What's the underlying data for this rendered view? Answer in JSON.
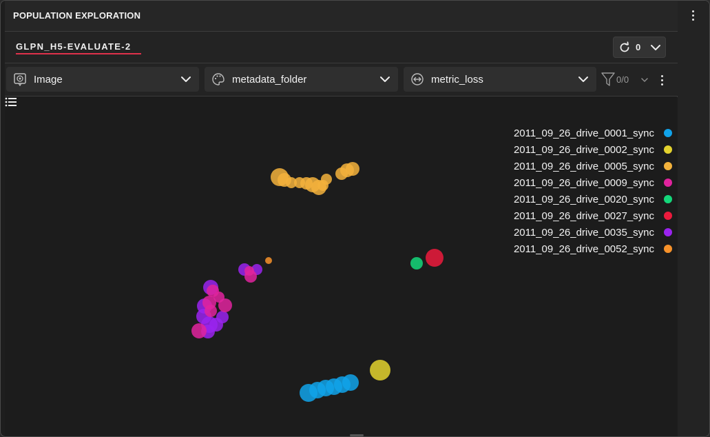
{
  "header": {
    "title": "POPULATION EXPLORATION"
  },
  "tab": {
    "label": "GLPN_H5-EVALUATE-2",
    "accent": "#e0314b"
  },
  "refresh": {
    "count": "0",
    "icon": "refresh-icon"
  },
  "controls": {
    "image_select": {
      "label": "Image",
      "icon": "image-icon"
    },
    "color_select": {
      "label": "metadata_folder",
      "icon": "palette-icon"
    },
    "size_select": {
      "label": "metric_loss",
      "icon": "resize-icon"
    },
    "filter": {
      "count": "0/0",
      "icon": "filter-icon"
    }
  },
  "legend": [
    {
      "label": "2011_09_26_drive_0001_sync",
      "color": "#11a3ea"
    },
    {
      "label": "2011_09_26_drive_0002_sync",
      "color": "#e3d22e"
    },
    {
      "label": "2011_09_26_drive_0005_sync",
      "color": "#f3b23c"
    },
    {
      "label": "2011_09_26_drive_0009_sync",
      "color": "#e1239e"
    },
    {
      "label": "2011_09_26_drive_0020_sync",
      "color": "#14d77a"
    },
    {
      "label": "2011_09_26_drive_0027_sync",
      "color": "#ec1a3c"
    },
    {
      "label": "2011_09_26_drive_0035_sync",
      "color": "#9a23ef"
    },
    {
      "label": "2011_09_26_drive_0052_sync",
      "color": "#f7922a"
    }
  ]
}
